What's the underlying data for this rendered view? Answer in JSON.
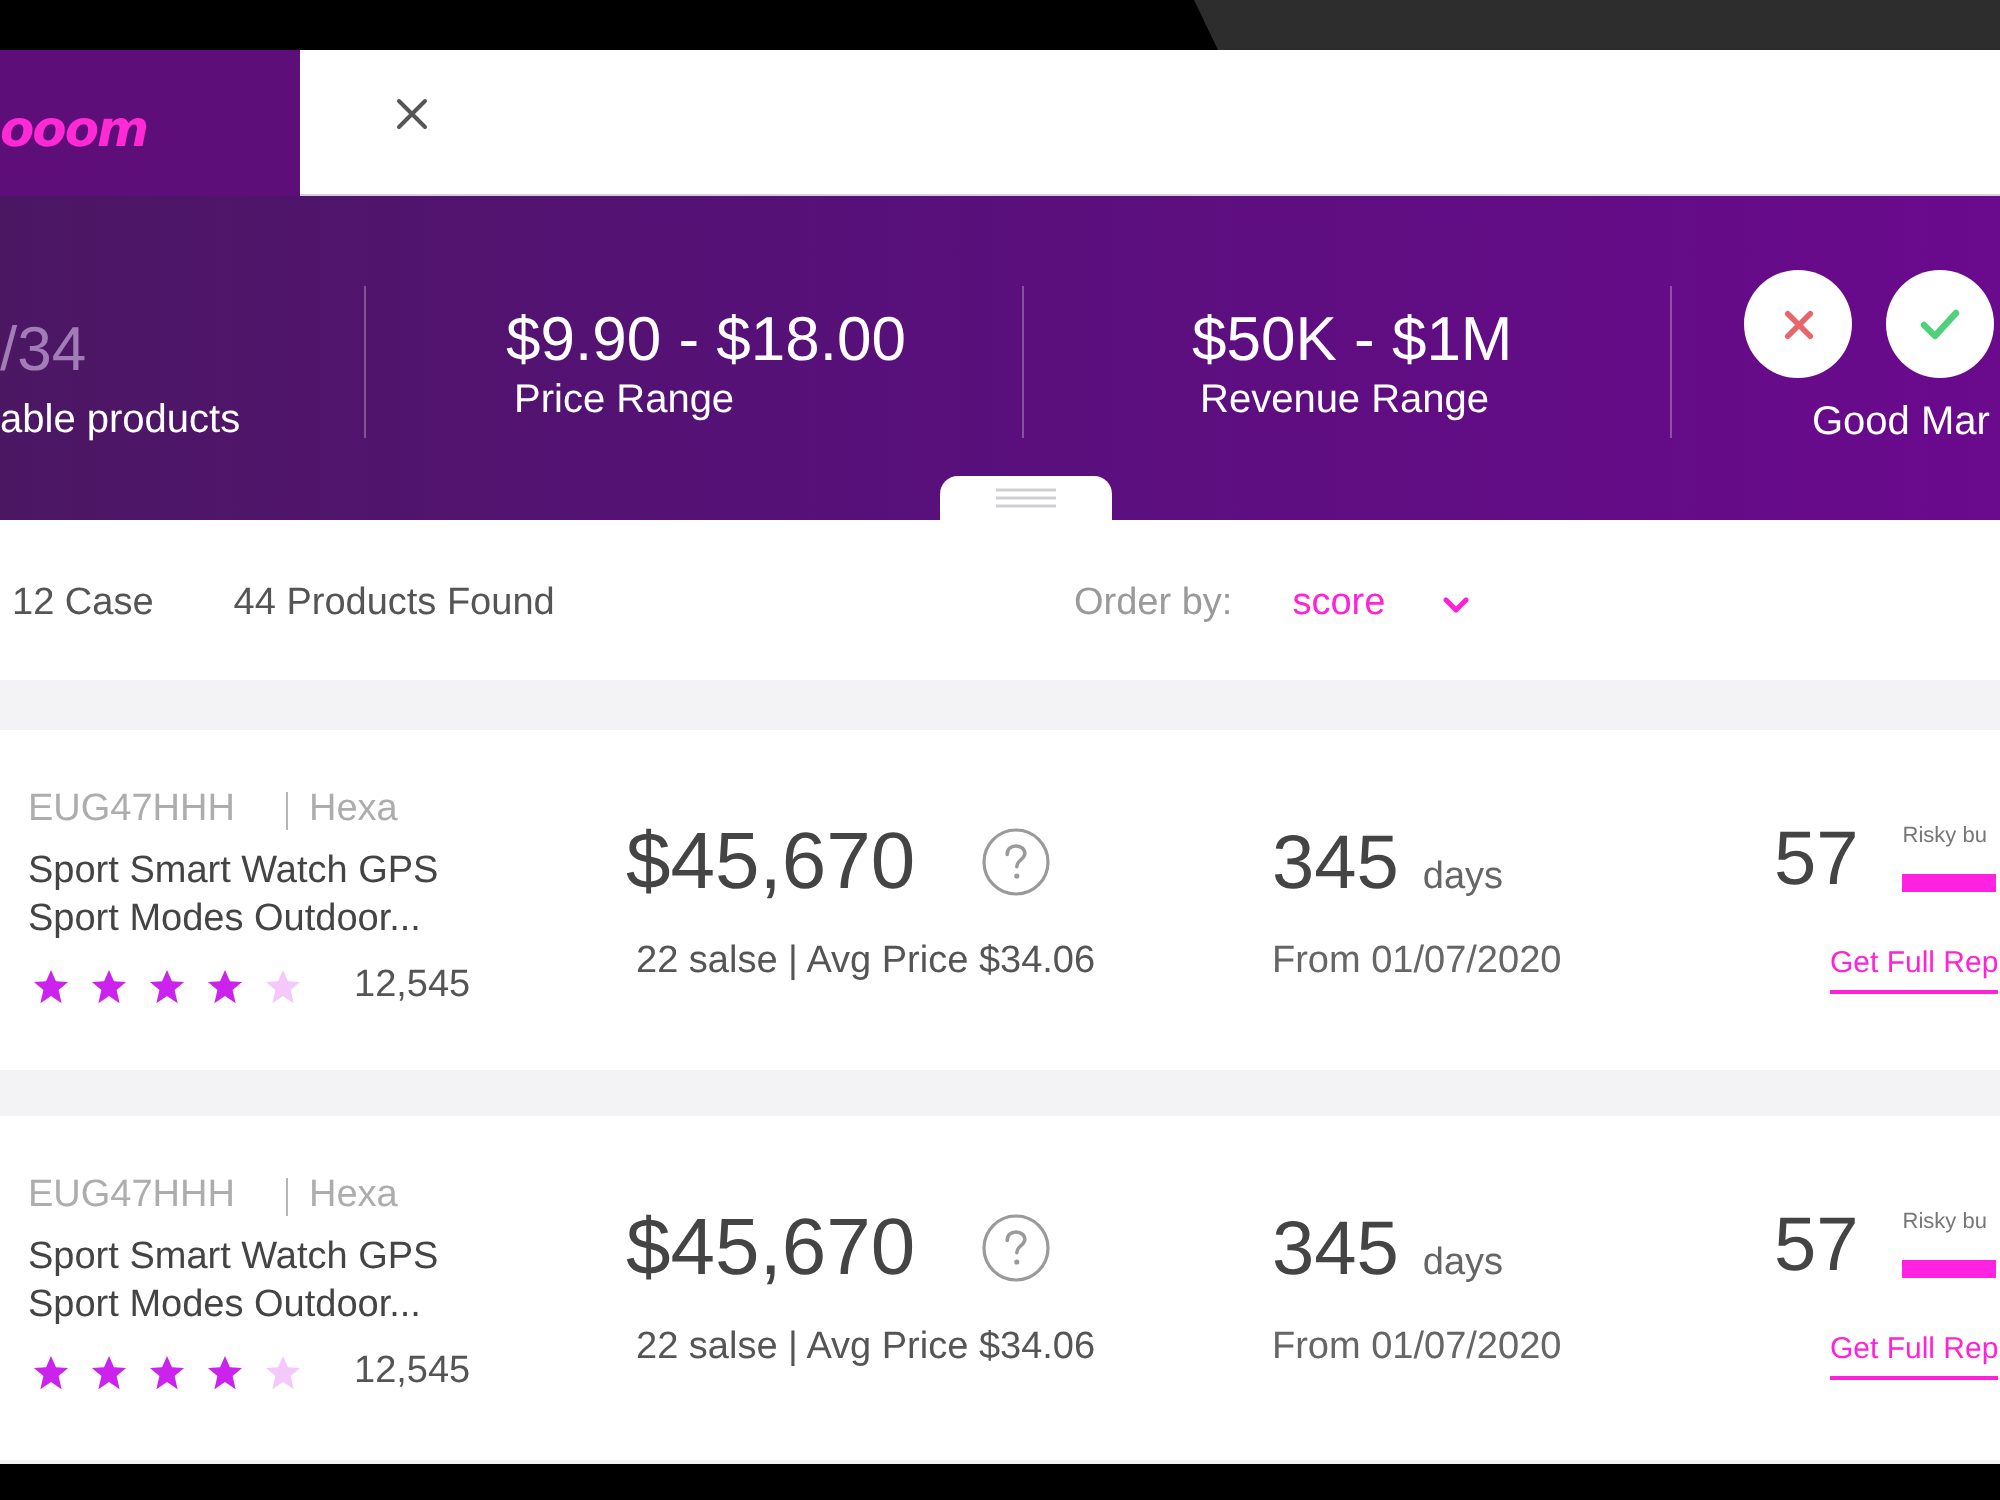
{
  "header": {
    "logo": "ooom"
  },
  "stats": [
    {
      "kind": "figure",
      "value": "/34",
      "label": "able products",
      "muted": true
    },
    {
      "kind": "figure",
      "value": "$9.90 - $18.00",
      "label": "Price Range",
      "muted": false
    },
    {
      "kind": "figure",
      "value": "$50K - $1M",
      "label": "Revenue Range",
      "muted": false
    },
    {
      "kind": "verdict",
      "buttons": [
        {
          "kind": "reject"
        },
        {
          "kind": "accept"
        }
      ],
      "label": "Good Mar"
    }
  ],
  "toolbar": {
    "case_count": "12 Case",
    "products_found": "44 Products Found",
    "order_by": {
      "label": "Order by:",
      "value": "score"
    }
  },
  "products": [
    {
      "sku": "EUG47HHH",
      "brand": "Hexa",
      "title": "Sport Smart Watch GPS Sport Modes Outdoor...",
      "stars": 4,
      "reviews": "12,545",
      "revenue": "$45,670",
      "sales": "22 salse | Avg Price $34.06",
      "age": "345",
      "age_unit": "days",
      "since": "From 01/07/2020",
      "score": "57",
      "risk_label": "Risky bu",
      "report_link": "Get Full Rep"
    },
    {
      "sku": "EUG47HHH",
      "brand": "Hexa",
      "title": "Sport Smart Watch GPS Sport Modes Outdoor...",
      "stars": 4,
      "reviews": "12,545",
      "revenue": "$45,670",
      "sales": "22 salse | Avg Price $34.06",
      "age": "345",
      "age_unit": "days",
      "since": "From 01/07/2020",
      "score": "57",
      "risk_label": "Risky bu",
      "report_link": "Get Full Rep"
    }
  ]
}
